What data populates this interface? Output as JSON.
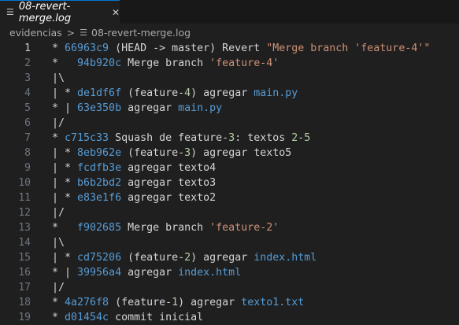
{
  "tab": {
    "filename": "08-revert-merge.log",
    "file_icon": "lines-icon",
    "close_icon": "close-icon"
  },
  "breadcrumb": {
    "folder": "evidencias",
    "separator": ">",
    "file": "08-revert-merge.log"
  },
  "lines": [
    {
      "n": "1",
      "t": [
        [
          "* ",
          ""
        ],
        [
          "66963c9",
          "hash"
        ],
        [
          " (HEAD -> master) Revert ",
          ""
        ],
        [
          "\"Merge branch 'feature-4'\"",
          "str"
        ]
      ]
    },
    {
      "n": "2",
      "t": [
        [
          "*   ",
          ""
        ],
        [
          "94b920c",
          "hash"
        ],
        [
          " Merge branch ",
          ""
        ],
        [
          "'feature-4'",
          "str"
        ]
      ]
    },
    {
      "n": "3",
      "t": [
        [
          "|\\",
          ""
        ]
      ]
    },
    {
      "n": "4",
      "t": [
        [
          "| * ",
          ""
        ],
        [
          "de1df6f",
          "hash"
        ],
        [
          " (feature-",
          ""
        ],
        [
          "4",
          "num"
        ],
        [
          ") agregar ",
          ""
        ],
        [
          "main.py",
          "hash"
        ]
      ]
    },
    {
      "n": "5",
      "t": [
        [
          "* | ",
          ""
        ],
        [
          "63e350b",
          "hash"
        ],
        [
          " agregar ",
          ""
        ],
        [
          "main.py",
          "hash"
        ]
      ]
    },
    {
      "n": "6",
      "t": [
        [
          "|/",
          ""
        ]
      ]
    },
    {
      "n": "7",
      "t": [
        [
          "* ",
          ""
        ],
        [
          "c715c33",
          "hash"
        ],
        [
          " Squash de feature-",
          ""
        ],
        [
          "3",
          "num"
        ],
        [
          ": textos ",
          ""
        ],
        [
          "2",
          "num"
        ],
        [
          "-",
          ""
        ],
        [
          "5",
          "num"
        ]
      ]
    },
    {
      "n": "8",
      "t": [
        [
          "| * ",
          ""
        ],
        [
          "8eb962e",
          "hash"
        ],
        [
          " (feature-",
          ""
        ],
        [
          "3",
          "num"
        ],
        [
          ") agregar texto5",
          ""
        ]
      ]
    },
    {
      "n": "9",
      "t": [
        [
          "| * ",
          ""
        ],
        [
          "fcdfb3e",
          "hash"
        ],
        [
          " agregar texto4",
          ""
        ]
      ]
    },
    {
      "n": "10",
      "t": [
        [
          "| * ",
          ""
        ],
        [
          "b6b2bd2",
          "hash"
        ],
        [
          " agregar texto3",
          ""
        ]
      ]
    },
    {
      "n": "11",
      "t": [
        [
          "| * ",
          ""
        ],
        [
          "e83e1f6",
          "hash"
        ],
        [
          " agregar texto2",
          ""
        ]
      ]
    },
    {
      "n": "12",
      "t": [
        [
          "|/",
          ""
        ]
      ]
    },
    {
      "n": "13",
      "t": [
        [
          "*   ",
          ""
        ],
        [
          "f902685",
          "hash"
        ],
        [
          " Merge branch ",
          ""
        ],
        [
          "'feature-2'",
          "str"
        ]
      ]
    },
    {
      "n": "14",
      "t": [
        [
          "|\\",
          ""
        ]
      ]
    },
    {
      "n": "15",
      "t": [
        [
          "| * ",
          ""
        ],
        [
          "cd75206",
          "hash"
        ],
        [
          " (feature-",
          ""
        ],
        [
          "2",
          "num"
        ],
        [
          ") agregar ",
          ""
        ],
        [
          "index.html",
          "hash"
        ]
      ]
    },
    {
      "n": "16",
      "t": [
        [
          "* | ",
          ""
        ],
        [
          "39956a4",
          "hash"
        ],
        [
          " agregar ",
          ""
        ],
        [
          "index.html",
          "hash"
        ]
      ]
    },
    {
      "n": "17",
      "t": [
        [
          "|/",
          ""
        ]
      ]
    },
    {
      "n": "18",
      "t": [
        [
          "* ",
          ""
        ],
        [
          "4a276f8",
          "hash"
        ],
        [
          " (feature-",
          ""
        ],
        [
          "1",
          "num"
        ],
        [
          ") agregar ",
          ""
        ],
        [
          "texto1.txt",
          "hash"
        ]
      ]
    },
    {
      "n": "19",
      "t": [
        [
          "* ",
          ""
        ],
        [
          "d01454c",
          "hash"
        ],
        [
          " commit inicial",
          ""
        ]
      ]
    }
  ],
  "colors": {
    "background": "#1f1f1f",
    "hash": "#569cd6",
    "string": "#ce9178",
    "number": "#b5cea8",
    "text": "#d4d4d4"
  }
}
